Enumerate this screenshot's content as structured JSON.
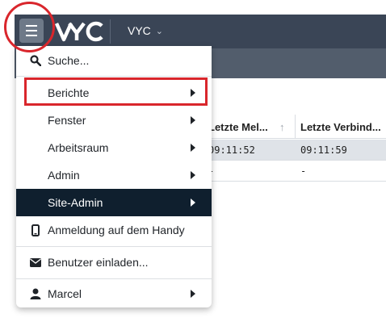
{
  "colors": {
    "topbar": "#3a4556",
    "subbar": "#525d6c",
    "menu_active_bg": "#0f1f2e",
    "annotation_red": "#d9262c",
    "selected_row": "#dfe3e8"
  },
  "header": {
    "logo_text": "VYC",
    "site_selector": "VYC",
    "menu_icon": "hamburger-icon"
  },
  "table": {
    "columns": [
      "Letzte Mel...",
      "Letzte Verbind..."
    ],
    "rows": [
      [
        "09:11:52",
        "09:11:59"
      ],
      [
        "-",
        "-"
      ]
    ]
  },
  "menu": {
    "search": {
      "label": "Suche...",
      "icon": "search-icon"
    },
    "items": [
      {
        "label": "Berichte",
        "has_submenu": true
      },
      {
        "label": "Fenster",
        "has_submenu": true
      },
      {
        "label": "Arbeitsraum",
        "has_submenu": true
      },
      {
        "label": "Admin",
        "has_submenu": true
      },
      {
        "label": "Site-Admin",
        "has_submenu": true,
        "active": true
      }
    ],
    "mobile_login": {
      "label": "Anmeldung auf dem Handy",
      "icon": "mobile-phone-icon"
    },
    "invite": {
      "label": "Benutzer einladen...",
      "icon": "envelope-icon"
    },
    "user": {
      "label": "Marcel",
      "icon": "user-icon",
      "has_submenu": true
    }
  }
}
